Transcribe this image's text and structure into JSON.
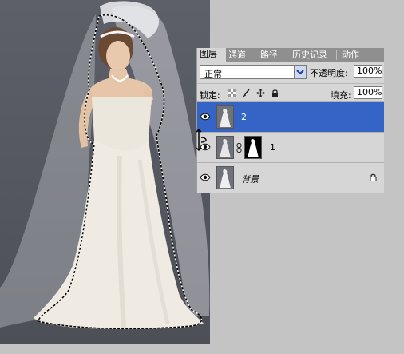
{
  "panel": {
    "tabs": [
      {
        "label": "图层",
        "active": true
      },
      {
        "label": "通道",
        "active": false
      },
      {
        "label": "路径",
        "active": false
      },
      {
        "label": "历史记录",
        "active": false
      },
      {
        "label": "动作",
        "active": false
      }
    ],
    "blend_mode": "正常",
    "opacity_label": "不透明度:",
    "opacity_value": "100%",
    "lock_label": "锁定:",
    "fill_label": "填充:",
    "fill_value": "100%",
    "layers": [
      {
        "name": "2",
        "selected": true
      },
      {
        "name": "1",
        "selected": false,
        "has_mask": true
      },
      {
        "name": "背景",
        "selected": false,
        "locked": true
      }
    ]
  },
  "colors": {
    "selection": "#3465c6",
    "canvas_bg": "#5e6069"
  },
  "icons": [
    "eye-icon",
    "chain-link-icon",
    "lock-icon",
    "brush-icon",
    "move-icon",
    "transparent-lock-icon",
    "chevron-down-icon"
  ]
}
